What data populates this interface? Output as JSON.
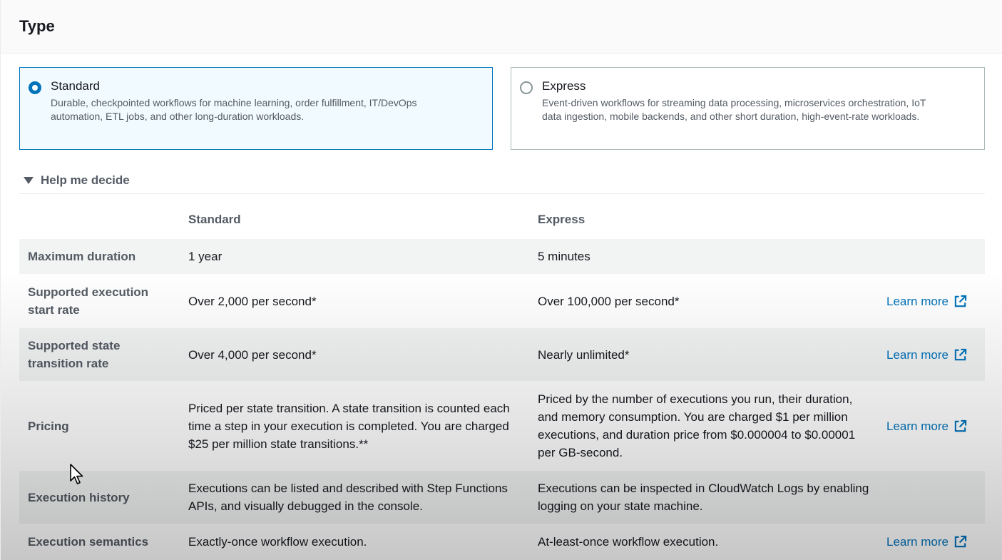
{
  "section": {
    "title": "Type"
  },
  "options": [
    {
      "label": "Standard",
      "description": "Durable, checkpointed workflows for machine learning, order fulfillment, IT/DevOps automation, ETL jobs, and other long-duration workloads.",
      "selected": true
    },
    {
      "label": "Express",
      "description": "Event-driven workflows for streaming data processing, microservices orchestration, IoT data ingestion, mobile backends, and other short duration, high-event-rate workloads.",
      "selected": false
    }
  ],
  "help": {
    "toggle_label": "Help me decide",
    "expanded": true,
    "columns": [
      "Standard",
      "Express"
    ],
    "link_label": "Learn more",
    "rows": [
      {
        "label": "Maximum duration",
        "standard": "1 year",
        "express": "5 minutes",
        "learn_more": false
      },
      {
        "label": "Supported execution start rate",
        "standard": "Over 2,000 per second*",
        "express": "Over 100,000 per second*",
        "learn_more": true
      },
      {
        "label": "Supported state transition rate",
        "standard": "Over 4,000 per second*",
        "express": "Nearly unlimited*",
        "learn_more": true
      },
      {
        "label": "Pricing",
        "standard": "Priced per state transition. A state transition is counted each time a step in your execution is completed. You are charged $25 per million state transitions.**",
        "express": "Priced by the number of executions you run, their duration, and memory consumption. You are charged $1 per million executions, and duration price from $0.000004 to $0.00001 per GB-second.",
        "learn_more": true
      },
      {
        "label": "Execution history",
        "standard": "Executions can be listed and described with Step Functions APIs, and visually debugged in the console.",
        "express": "Executions can be inspected in CloudWatch Logs by enabling logging on your state machine.",
        "learn_more": false
      },
      {
        "label": "Execution semantics",
        "standard": "Exactly-once workflow execution.",
        "express": "At-least-once workflow execution.",
        "learn_more": true
      }
    ]
  },
  "colors": {
    "accent": "#0073bb",
    "shaded_row": "#f2f3f3",
    "muted_text": "#545b64"
  },
  "icons": {
    "external_link": "external-link-icon",
    "caret": "caret-down-icon",
    "cursor": "mouse-pointer-icon"
  }
}
